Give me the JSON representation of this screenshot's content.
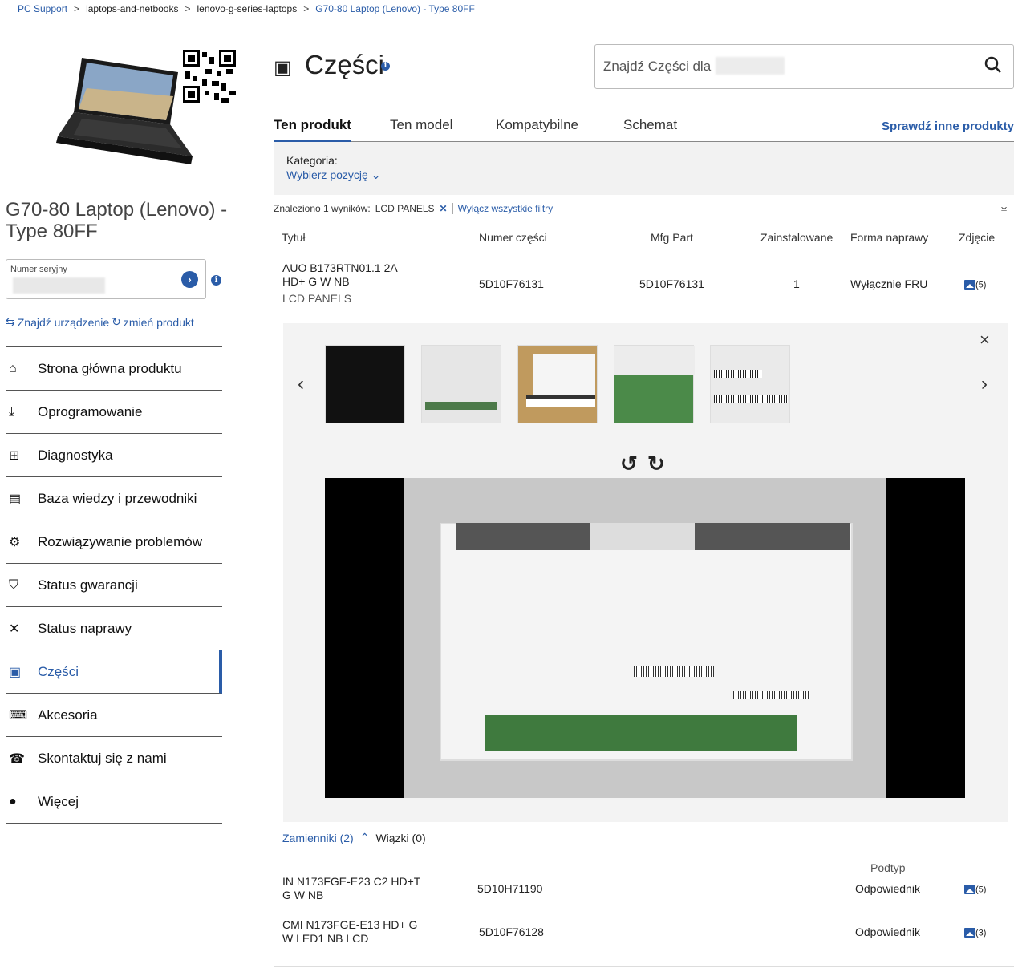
{
  "breadcrumb": {
    "items": [
      "PC Support",
      "laptops-and-netbooks",
      "lenovo-g-series-laptops",
      "G70-80 Laptop (Lenovo) - Type 80FF"
    ],
    "separator": ">"
  },
  "product": {
    "title": "G70-80 Laptop (Lenovo) - Type 80FF",
    "serial_label": "Numer seryjny",
    "find_device": "Znajdź urządzenie",
    "change_product": "zmień produkt"
  },
  "sidebar": {
    "items": [
      {
        "label": "Strona główna produktu",
        "icon": "home-icon"
      },
      {
        "label": "Oprogramowanie",
        "icon": "download-icon"
      },
      {
        "label": "Diagnostyka",
        "icon": "medkit-icon"
      },
      {
        "label": "Baza wiedzy i przewodniki",
        "icon": "document-icon"
      },
      {
        "label": "Rozwiązywanie problemów",
        "icon": "troubleshoot-icon"
      },
      {
        "label": "Status gwarancji",
        "icon": "shield-icon"
      },
      {
        "label": "Status naprawy",
        "icon": "tools-icon"
      },
      {
        "label": "Części",
        "icon": "chip-icon",
        "active": true
      },
      {
        "label": "Akcesoria",
        "icon": "keyboard-icon"
      },
      {
        "label": "Skontaktuj się z nami",
        "icon": "contact-icon"
      },
      {
        "label": "Więcej",
        "icon": "more-icon"
      }
    ]
  },
  "header": {
    "title": "Części",
    "search_placeholder": "Znajdź Części dla"
  },
  "tabs": [
    "Ten produkt",
    "Ten model",
    "Kompatybilne",
    "Schemat"
  ],
  "tab_other": "Sprawdź inne produkty",
  "filters": {
    "category_label": "Kategoria:",
    "category_select": "Wybierz pozycję",
    "result_text": "Znaleziono 1 wyników:",
    "active_chip": "LCD PANELS",
    "clear_all": "Wyłącz wszystkie filtry"
  },
  "table": {
    "headers": [
      "Tytuł",
      "Numer części",
      "Mfg Part",
      "Zainstalowane",
      "Forma naprawy",
      "Zdjęcie"
    ],
    "row": {
      "title_line1": "AUO B173RTN01.1 2A",
      "title_line2": "HD+ G W NB",
      "category": "LCD PANELS",
      "part_number": "5D10F76131",
      "mfg_part": "5D10F76131",
      "installed": "1",
      "repair_form": "Wyłącznie FRU",
      "photo_count": "(5)"
    }
  },
  "gallery": {
    "thumb_count": 5
  },
  "alternatives": {
    "alt_label": "Zamienniki (2)",
    "bundle_label": "Wiązki (0)",
    "subtype_header": "Podtyp",
    "rows": [
      {
        "title_line1": "IN N173FGE-E23 C2 HD+T",
        "title_line2": "G W NB",
        "part": "5D10H71190",
        "subtype": "Odpowiednik",
        "photos": "(5)"
      },
      {
        "title_line1": "CMI N173FGE-E13 HD+ G",
        "title_line2": "W LED1 NB LCD",
        "part": "5D10F76128",
        "subtype": "Odpowiednik",
        "photos": "(3)"
      }
    ]
  },
  "colors": {
    "accent": "#2a5ca8"
  }
}
